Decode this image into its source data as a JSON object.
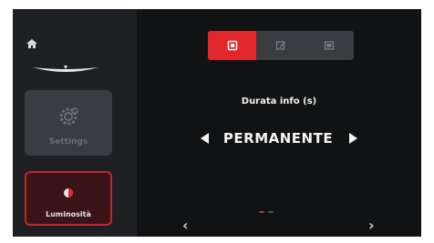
{
  "sidebar": {
    "icons": {
      "home": "home-icon",
      "logo": "brand-logo"
    },
    "items": [
      {
        "label": "Settings",
        "icon": "gear-icon",
        "active": false
      },
      {
        "label": "Luminosità",
        "icon": "brightness-icon",
        "active": true
      }
    ]
  },
  "tabs": [
    {
      "icon": "info-display-icon",
      "active": true
    },
    {
      "icon": "edit-icon",
      "active": false
    },
    {
      "icon": "screen-icon",
      "active": false
    }
  ],
  "setting": {
    "title": "Durata info (s)",
    "value": "PERMANENTE"
  },
  "navigation": {
    "prev": "‹",
    "next": "›"
  },
  "pager": {
    "pages": 2,
    "current": 1
  },
  "colors": {
    "accent": "#e0282c",
    "background": "#111214",
    "sidebar": "#1e2024"
  }
}
